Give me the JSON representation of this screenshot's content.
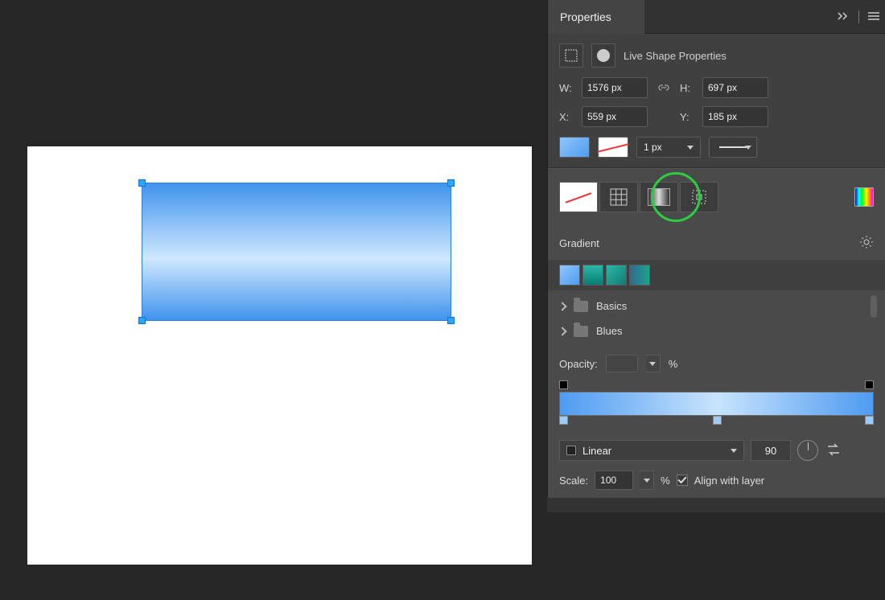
{
  "panel": {
    "tab_title": "Properties",
    "section_title": "Live Shape Properties",
    "w_label": "W:",
    "h_label": "H:",
    "x_label": "X:",
    "y_label": "Y:",
    "width_value": "1576 px",
    "height_value": "697 px",
    "x_value": "559 px",
    "y_value": "185 px",
    "stroke_width": "1 px"
  },
  "gradient": {
    "title": "Gradient",
    "folders": [
      "Basics",
      "Blues"
    ],
    "opacity_label": "Opacity:",
    "opacity_value": "",
    "percent": "%",
    "type_label": "Linear",
    "angle": "90",
    "scale_label": "Scale:",
    "scale_value": "100",
    "align_label": "Align with layer"
  }
}
